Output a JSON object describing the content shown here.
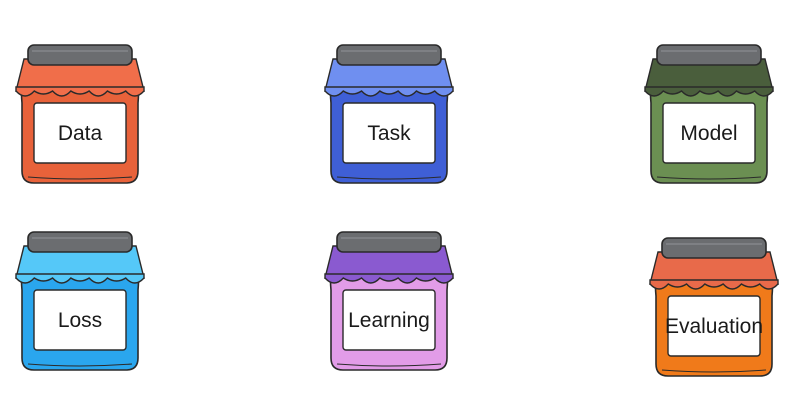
{
  "jars": [
    {
      "label": "Data",
      "body_color": "#e8623a",
      "cloth_color": "#f06e4a"
    },
    {
      "label": "Task",
      "body_color": "#3f5fd6",
      "cloth_color": "#6f8ff0"
    },
    {
      "label": "Model",
      "body_color": "#6b8f52",
      "cloth_color": "#4a5e3c"
    },
    {
      "label": "Loss",
      "body_color": "#2aa6ee",
      "cloth_color": "#55c8f8"
    },
    {
      "label": "Learning",
      "body_color": "#e29ce8",
      "cloth_color": "#8a5ad0"
    },
    {
      "label": "Evaluation",
      "body_color": "#f07a1a",
      "cloth_color": "#e86a4a"
    }
  ],
  "lid_color": "#6b6d70"
}
